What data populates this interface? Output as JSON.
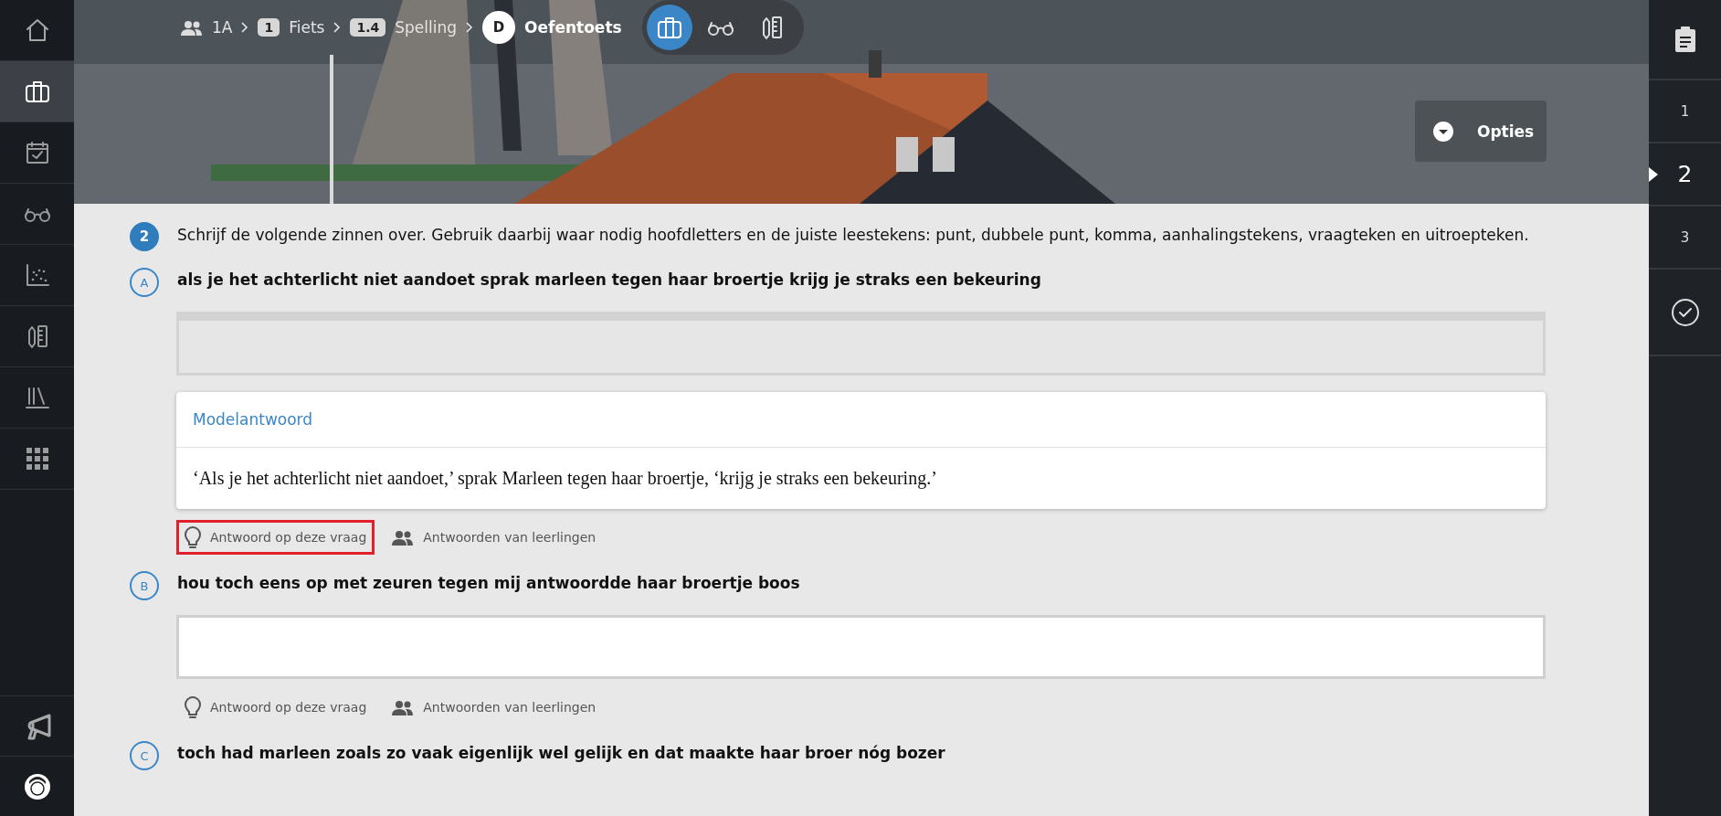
{
  "sidebar": {
    "items": [
      {
        "kind": "home",
        "selected": false
      },
      {
        "kind": "briefcase",
        "selected": true
      },
      {
        "kind": "calendar",
        "selected": false
      },
      {
        "kind": "glasses",
        "selected": false
      },
      {
        "kind": "scatter",
        "selected": false
      },
      {
        "kind": "pencil-ruler",
        "selected": false
      },
      {
        "kind": "books",
        "selected": false
      },
      {
        "kind": "grid",
        "selected": false
      }
    ],
    "bottom_items": [
      {
        "kind": "megaphone",
        "selected": false
      },
      {
        "kind": "avatar",
        "selected": false
      }
    ]
  },
  "header": {
    "breadcrumb": [
      {
        "kind": "group",
        "label": "1A"
      },
      {
        "kind": "badge",
        "badge": "1",
        "label": "Fiets"
      },
      {
        "kind": "badge",
        "badge": "1.4",
        "label": "Spelling"
      },
      {
        "kind": "circle",
        "badge": "D",
        "label": "Oefentoets"
      }
    ],
    "tools": [
      {
        "kind": "briefcase",
        "selected": true
      },
      {
        "kind": "glasses",
        "selected": false
      },
      {
        "kind": "pencil-ruler",
        "selected": false
      }
    ],
    "options_button": "Opties"
  },
  "question": {
    "number": "2",
    "text": "Schrijf de volgende zinnen over. Gebruik daarbij waar nodig hoofdletters en de juiste leestekens: punt, dubbele punt, komma, aanhalingstekens, vraagteken en uitroepteken.",
    "parts": [
      {
        "letter": "A",
        "prompt": "als je het achterlicht niet aandoet sprak marleen tegen haar broertje krijg je straks een bekeuring",
        "answer_field": {
          "disabled": true
        },
        "model_answer": {
          "title": "Modelantwoord",
          "text": "‘Als je het achterlicht niet aandoet,’ sprak Marleen tegen haar broertje, ‘krijg je straks een bekeuring.’"
        },
        "links": [
          {
            "kind": "hint",
            "label": "Antwoord op deze vraag",
            "highlighted": true
          },
          {
            "kind": "students",
            "label": "Antwoorden van leerlingen",
            "highlighted": false
          }
        ]
      },
      {
        "letter": "B",
        "prompt": "hou toch eens op met zeuren tegen mij antwoordde haar broertje boos",
        "answer_field": {
          "disabled": false
        },
        "links": [
          {
            "kind": "hint",
            "label": "Antwoord op deze vraag",
            "highlighted": false
          },
          {
            "kind": "students",
            "label": "Antwoorden van leerlingen",
            "highlighted": false
          }
        ]
      },
      {
        "letter": "C",
        "prompt": "toch had marleen zoals zo vaak eigenlijk wel gelijk en dat maakte haar broer nóg bozer"
      }
    ]
  },
  "question_nav": {
    "items": [
      {
        "kind": "clipboard",
        "selected": false
      },
      {
        "kind": "number",
        "label": "1",
        "selected": false
      },
      {
        "kind": "number",
        "label": "2",
        "selected": true
      },
      {
        "kind": "number",
        "label": "3",
        "selected": false
      },
      {
        "kind": "check",
        "selected": false
      }
    ]
  }
}
